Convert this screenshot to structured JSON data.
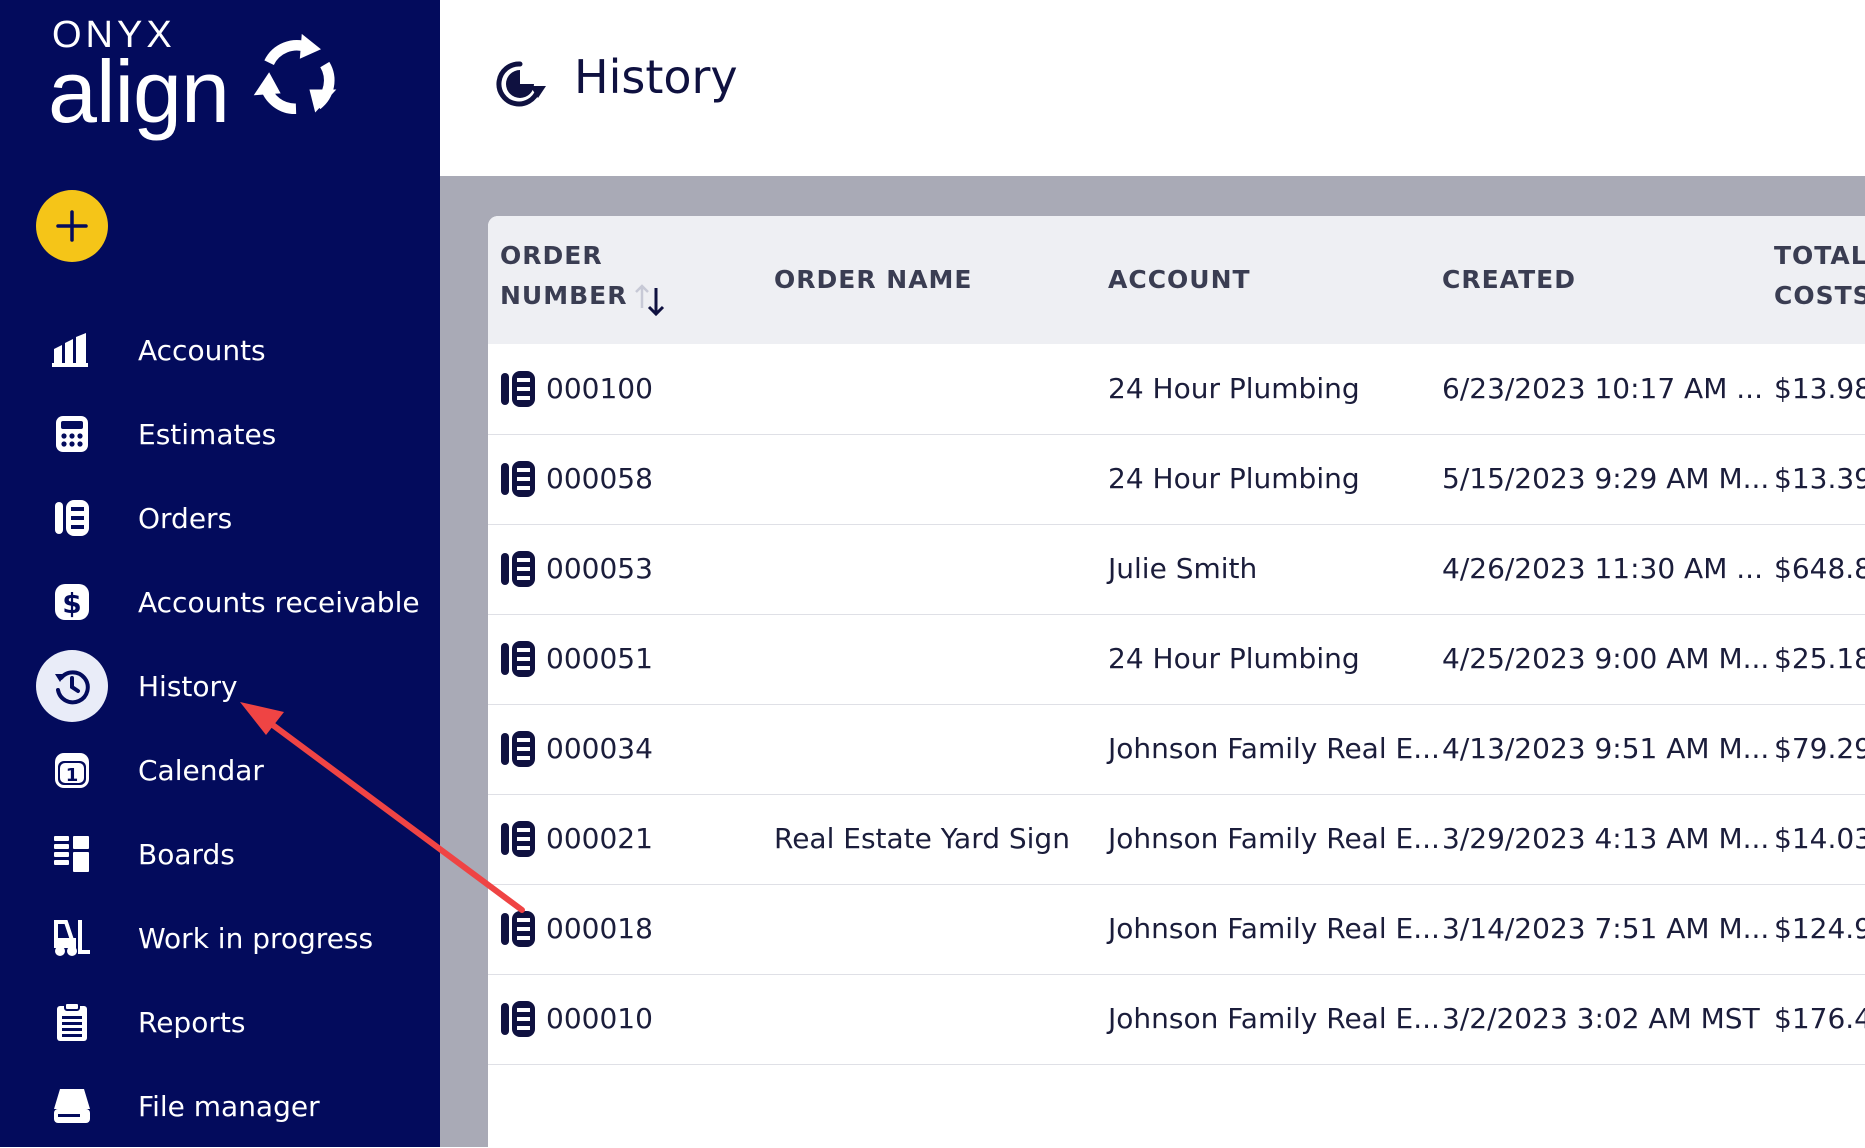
{
  "brand": {
    "top": "ONYX",
    "name": "align"
  },
  "sidebar": {
    "add_button_label": "+",
    "items": [
      {
        "label": "Accounts",
        "icon": "accounts-icon",
        "active": false
      },
      {
        "label": "Estimates",
        "icon": "calculator-icon",
        "active": false
      },
      {
        "label": "Orders",
        "icon": "orders-icon",
        "active": false
      },
      {
        "label": "Accounts receivable",
        "icon": "dollar-icon",
        "active": false
      },
      {
        "label": "History",
        "icon": "history-icon",
        "active": true
      },
      {
        "label": "Calendar",
        "icon": "calendar-icon",
        "active": false
      },
      {
        "label": "Boards",
        "icon": "boards-icon",
        "active": false
      },
      {
        "label": "Work in progress",
        "icon": "forklift-icon",
        "active": false
      },
      {
        "label": "Reports",
        "icon": "clipboard-icon",
        "active": false
      },
      {
        "label": "File manager",
        "icon": "drive-icon",
        "active": false
      }
    ]
  },
  "header": {
    "title": "History",
    "icon": "history-icon"
  },
  "table": {
    "columns": {
      "order_number_line1": "ORDER",
      "order_number_line2": "NUMBER",
      "order_name": "ORDER NAME",
      "account": "ACCOUNT",
      "created": "CREATED",
      "total_costs_line1": "TOTAL",
      "total_costs_line2": "COSTS"
    },
    "rows": [
      {
        "order_number": "000100",
        "order_name": "",
        "account": "24 Hour Plumbing",
        "created": "6/23/2023 10:17 AM ...",
        "total": "$13.98"
      },
      {
        "order_number": "000058",
        "order_name": "",
        "account": "24 Hour Plumbing",
        "created": "5/15/2023 9:29 AM M...",
        "total": "$13.39"
      },
      {
        "order_number": "000053",
        "order_name": "",
        "account": "Julie Smith",
        "created": "4/26/2023 11:30 AM ...",
        "total": "$648.8"
      },
      {
        "order_number": "000051",
        "order_name": "",
        "account": "24 Hour Plumbing",
        "created": "4/25/2023 9:00 AM M...",
        "total": "$25.18"
      },
      {
        "order_number": "000034",
        "order_name": "",
        "account": "Johnson Family Real E...",
        "created": "4/13/2023 9:51 AM M...",
        "total": "$79.29"
      },
      {
        "order_number": "000021",
        "order_name": "Real Estate Yard Sign",
        "account": "Johnson Family Real E...",
        "created": "3/29/2023 4:13 AM M...",
        "total": "$14.03"
      },
      {
        "order_number": "000018",
        "order_name": "",
        "account": "Johnson Family Real E...",
        "created": "3/14/2023 7:51 AM M...",
        "total": "$124.9"
      },
      {
        "order_number": "000010",
        "order_name": "",
        "account": "Johnson Family Real E...",
        "created": "3/2/2023 3:02 AM MST",
        "total": "$176.4"
      }
    ]
  },
  "colors": {
    "sidebar_bg": "#030b5c",
    "add_button": "#f5c518",
    "annotation_arrow": "#ef4444",
    "active_nav_bg": "#e9ecf8"
  }
}
